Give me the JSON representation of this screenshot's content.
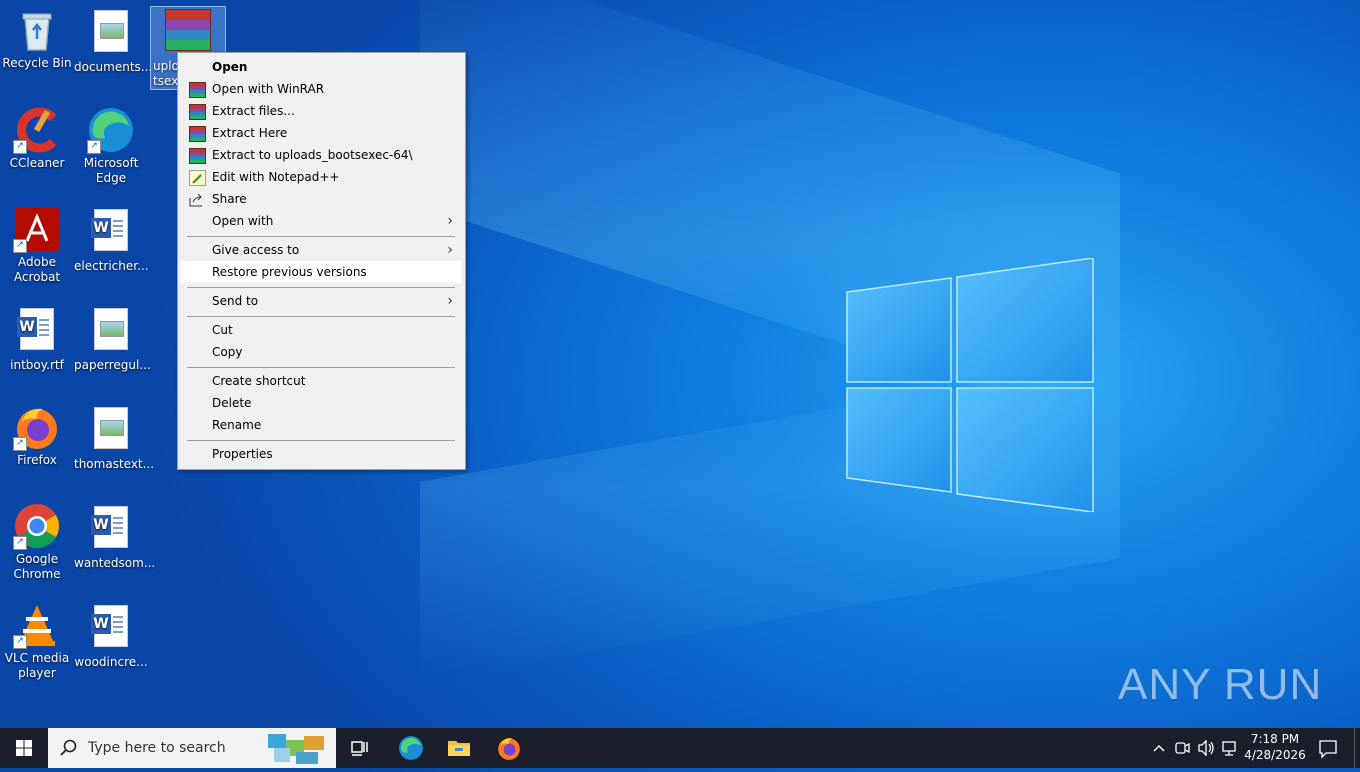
{
  "desktop": {
    "icons": [
      {
        "label": "Recycle Bin"
      },
      {
        "label": "documents..."
      },
      {
        "label": "uplo\ntsexe"
      },
      {
        "label": "CCleaner"
      },
      {
        "label": "Microsoft Edge"
      },
      {
        "label": "Adobe Acrobat"
      },
      {
        "label": "electricher..."
      },
      {
        "label": "intboy.rtf"
      },
      {
        "label": "paperregul..."
      },
      {
        "label": "Firefox"
      },
      {
        "label": "thomastext..."
      },
      {
        "label": "Google Chrome"
      },
      {
        "label": "wantedsom..."
      },
      {
        "label": "VLC media player"
      },
      {
        "label": "woodincre..."
      }
    ]
  },
  "context_menu": {
    "items": [
      {
        "label": "Open"
      },
      {
        "label": "Open with WinRAR"
      },
      {
        "label": "Extract files..."
      },
      {
        "label": "Extract Here"
      },
      {
        "label": "Extract to uploads_bootsexec-64\\"
      },
      {
        "label": "Edit with Notepad++"
      },
      {
        "label": "Share"
      },
      {
        "label": "Open with"
      },
      {
        "label": "Give access to"
      },
      {
        "label": "Restore previous versions"
      },
      {
        "label": "Send to"
      },
      {
        "label": "Cut"
      },
      {
        "label": "Copy"
      },
      {
        "label": "Create shortcut"
      },
      {
        "label": "Delete"
      },
      {
        "label": "Rename"
      },
      {
        "label": "Properties"
      }
    ]
  },
  "taskbar": {
    "search_placeholder": "Type here to search",
    "time": "7:18 PM",
    "date": "4/28/2026"
  },
  "watermark": "ANY RUN",
  "colors": {
    "accent": "#0a5cc4",
    "taskbar": "#1b1f2b",
    "menu_bg": "#f0f0f0"
  }
}
